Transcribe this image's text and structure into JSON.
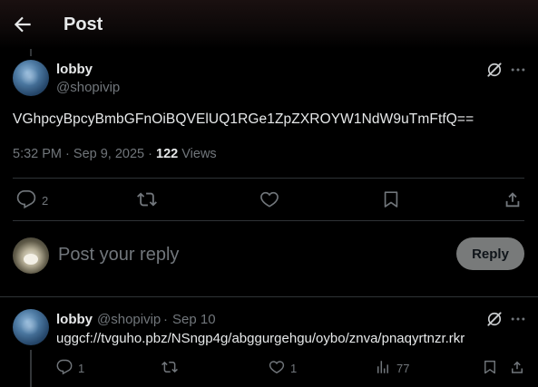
{
  "header": {
    "title": "Post"
  },
  "post": {
    "author_name": "lobby",
    "author_handle": "@shopivip",
    "text": "VGhpcyBpcyBmbGFnOiBQVElUQ1RGe1ZpZXROYW1NdW9uTmFtfQ==",
    "time": "5:32 PM",
    "separator": "·",
    "date": "Sep 9, 2025",
    "views_count": "122",
    "views_label": "Views",
    "reply_count": "2"
  },
  "composer": {
    "placeholder": "Post your reply",
    "button_label": "Reply"
  },
  "reply": {
    "author_name": "lobby",
    "author_handle": "@shopivip",
    "separator": "·",
    "date": "Sep 10",
    "text": "uggcf://tvguho.pbz/NSngp4g/abggurgehgu/oybo/znva/pnaqyrtnzr.rkr",
    "reply_count": "1",
    "like_count": "1",
    "views_count": "77"
  },
  "icons": {
    "back": "arrow-left-icon",
    "grok": "grok-icon",
    "more": "more-icon",
    "reply": "reply-icon",
    "repost": "repost-icon",
    "like": "heart-icon",
    "bookmark": "bookmark-icon",
    "share": "share-icon",
    "views": "views-chart-icon"
  }
}
